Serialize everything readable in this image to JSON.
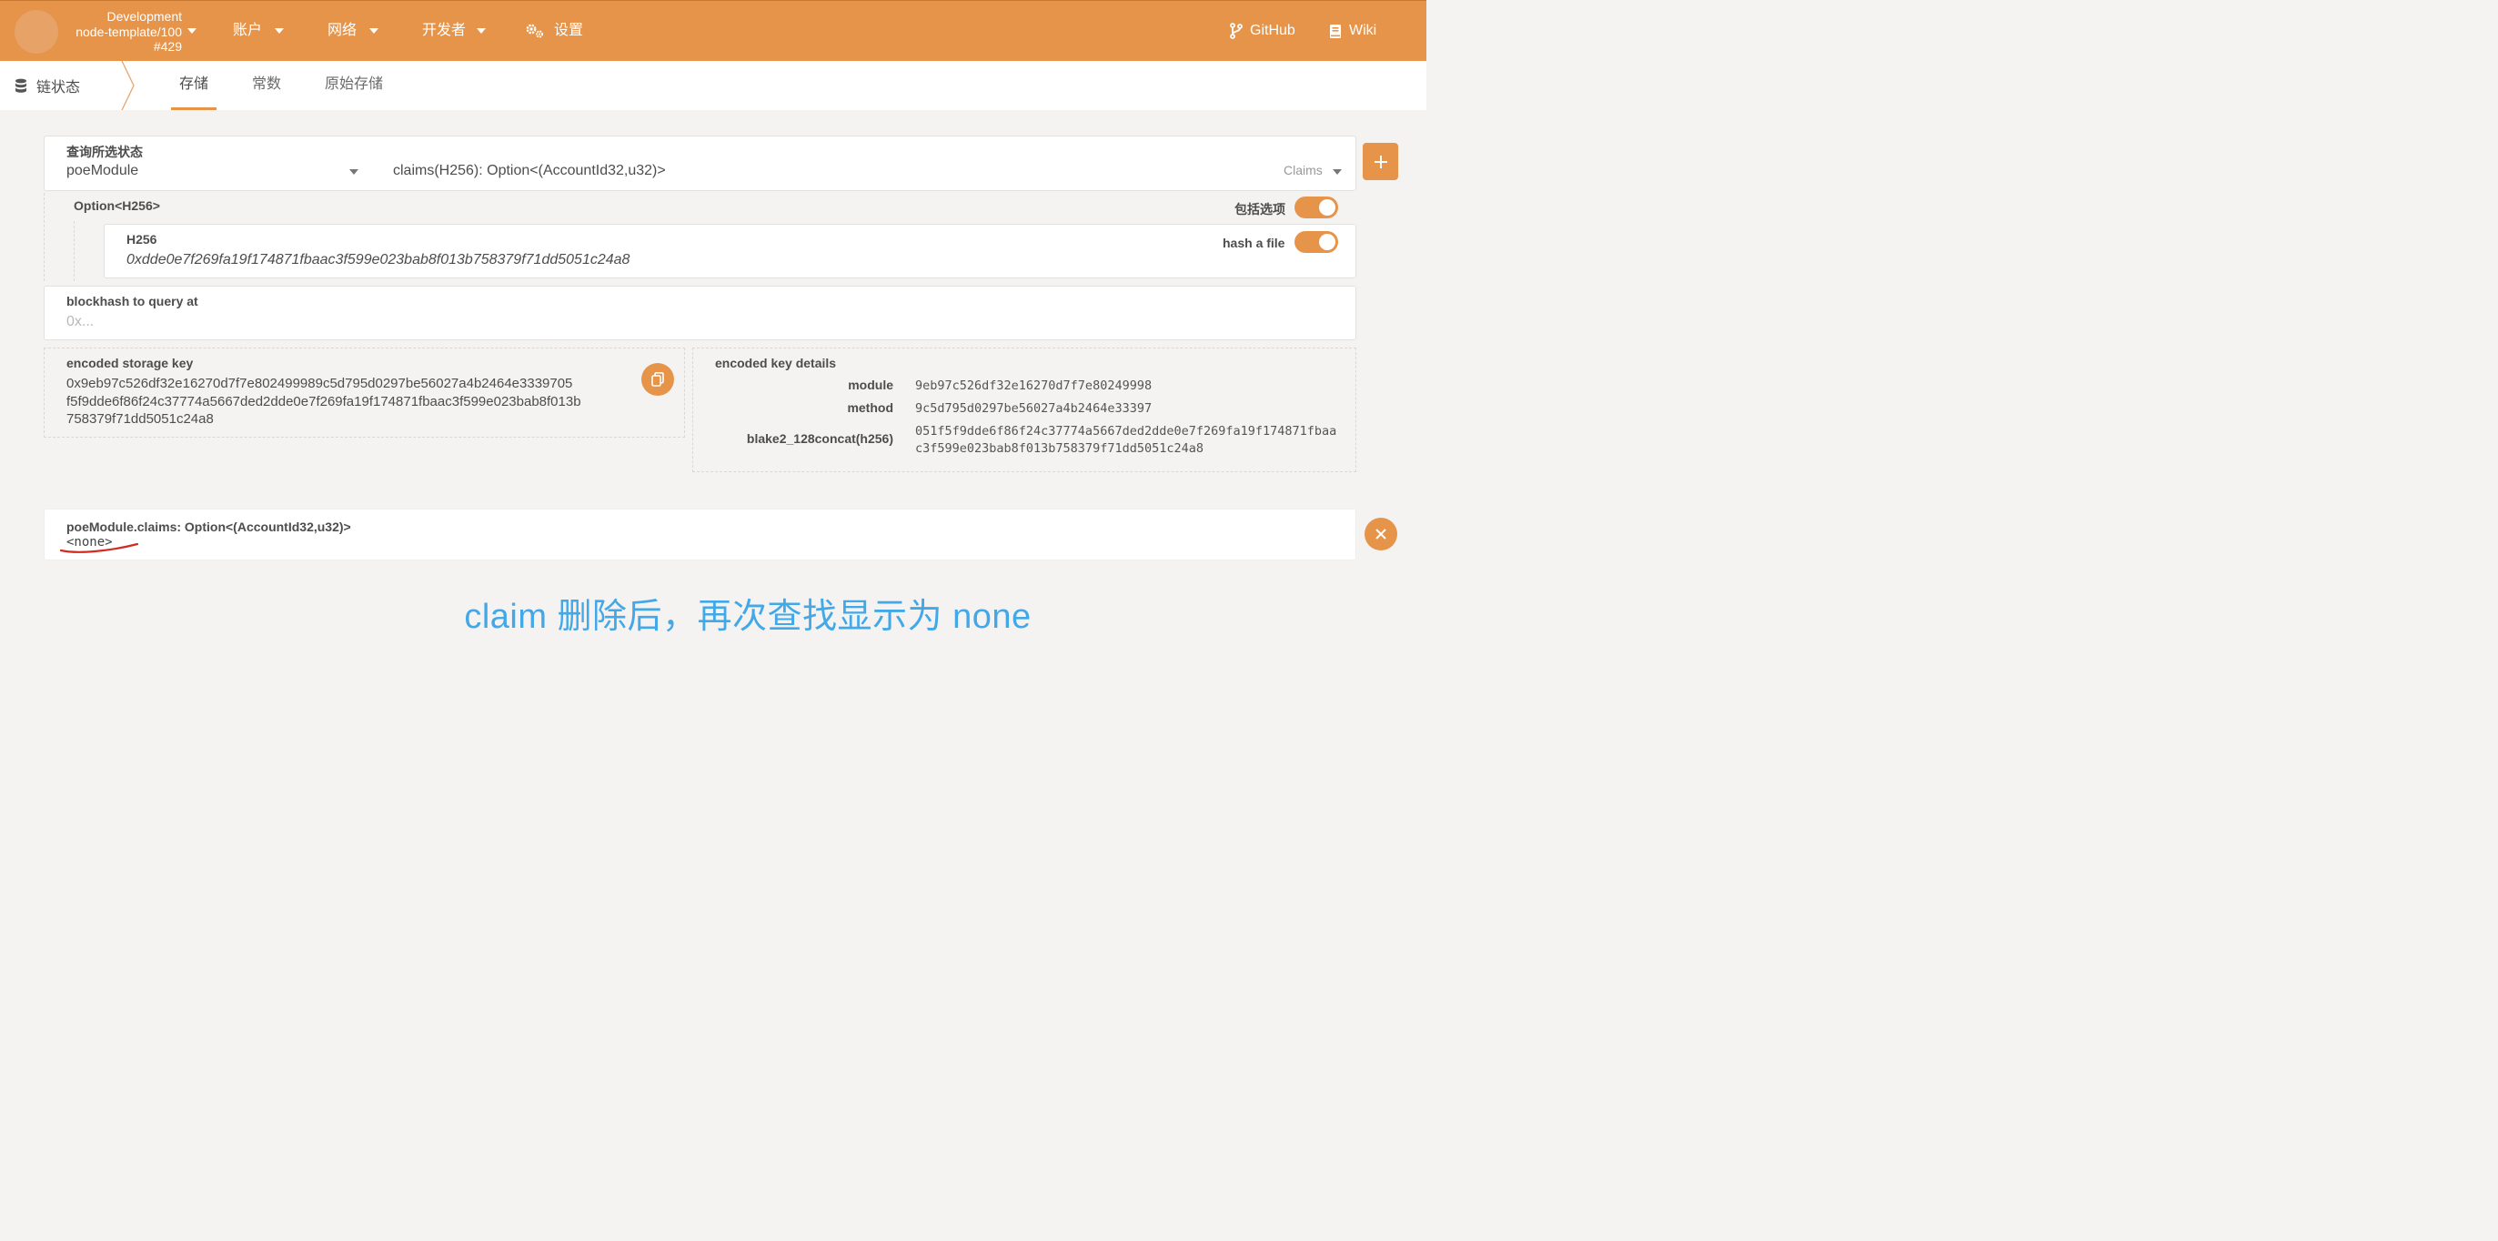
{
  "header": {
    "chain": {
      "network": "Development",
      "runtime": "node-template/100",
      "block": "#429"
    },
    "nav": [
      {
        "label": "账户",
        "icon": "caret-down-icon"
      },
      {
        "label": "网络",
        "icon": "caret-down-icon"
      },
      {
        "label": "开发者",
        "icon": "caret-down-icon"
      },
      {
        "label": "设置",
        "icon": "gears-icon"
      }
    ],
    "links": [
      {
        "label": "GitHub",
        "icon": "code-branch-icon"
      },
      {
        "label": "Wiki",
        "icon": "book-icon"
      }
    ]
  },
  "tabbar": {
    "section": "链状态",
    "section_icon": "database-icon",
    "tabs": [
      {
        "label": "存储",
        "active": true
      },
      {
        "label": "常数",
        "active": false
      },
      {
        "label": "原始存储",
        "active": false
      }
    ]
  },
  "query": {
    "label": "查询所选状态",
    "module": "poeModule",
    "method": "claims(H256): Option<(AccountId32,u32)>",
    "method_name": "Claims",
    "add_icon": "plus-icon"
  },
  "option_param": {
    "type": "Option<H256>",
    "toggle_label": "包括选项",
    "toggle_on": true
  },
  "hash_param": {
    "label": "H256",
    "value": "0xdde0e7f269fa19f174871fbaac3f599e023bab8f013b758379f71dd5051c24a8",
    "toggle_label": "hash a file",
    "toggle_on": true
  },
  "blockhash": {
    "label": "blockhash to query at",
    "placeholder": "0x..."
  },
  "encoded_key": {
    "label": "encoded storage key",
    "lines": [
      "0x9eb97c526df32e16270d7f7e802499989c5d795d0297be56027a4b2464e3339705",
      "f5f9dde6f86f24c37774a5667ded2dde0e7f269fa19f174871fbaac3f599e023bab8f013b",
      "758379f71dd5051c24a8"
    ],
    "copy_icon": "copy-icon"
  },
  "key_details": {
    "label": "encoded key details",
    "rows": [
      {
        "key": "module",
        "value": "9eb97c526df32e16270d7f7e80249998"
      },
      {
        "key": "method",
        "value": "9c5d795d0297be56027a4b2464e33397"
      },
      {
        "key": "blake2_128concat(h256)",
        "value": "051f5f9dde6f86f24c37774a5667ded2dde0e7f269fa19f174871fbaac3f599e023bab8f013b758379f71dd5051c24a8"
      }
    ]
  },
  "result": {
    "label": "poeModule.claims: Option<(AccountId32,u32)>",
    "value": "<none>",
    "close_icon": "close-icon"
  },
  "annotation": "claim 删除后，再次查找显示为 none",
  "colors": {
    "accent": "#e5944a",
    "annotation": "#42a8e8",
    "underline": "#d42a1f"
  }
}
